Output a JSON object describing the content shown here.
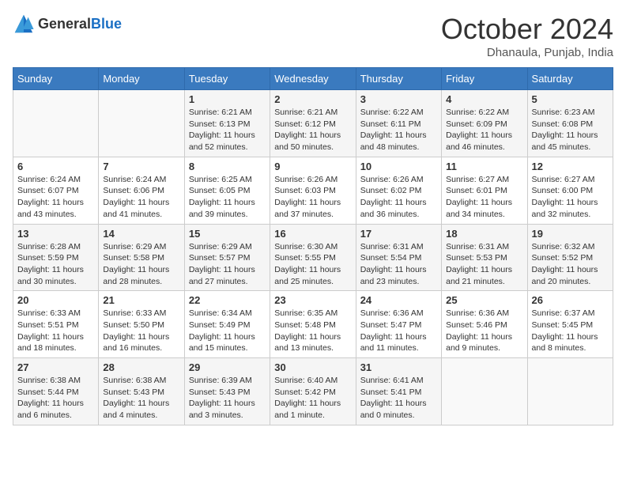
{
  "header": {
    "logo_general": "General",
    "logo_blue": "Blue",
    "title": "October 2024",
    "location": "Dhanaula, Punjab, India"
  },
  "calendar": {
    "days_of_week": [
      "Sunday",
      "Monday",
      "Tuesday",
      "Wednesday",
      "Thursday",
      "Friday",
      "Saturday"
    ],
    "weeks": [
      [
        {
          "day": "",
          "info": ""
        },
        {
          "day": "",
          "info": ""
        },
        {
          "day": "1",
          "info": "Sunrise: 6:21 AM\nSunset: 6:13 PM\nDaylight: 11 hours and 52 minutes."
        },
        {
          "day": "2",
          "info": "Sunrise: 6:21 AM\nSunset: 6:12 PM\nDaylight: 11 hours and 50 minutes."
        },
        {
          "day": "3",
          "info": "Sunrise: 6:22 AM\nSunset: 6:11 PM\nDaylight: 11 hours and 48 minutes."
        },
        {
          "day": "4",
          "info": "Sunrise: 6:22 AM\nSunset: 6:09 PM\nDaylight: 11 hours and 46 minutes."
        },
        {
          "day": "5",
          "info": "Sunrise: 6:23 AM\nSunset: 6:08 PM\nDaylight: 11 hours and 45 minutes."
        }
      ],
      [
        {
          "day": "6",
          "info": "Sunrise: 6:24 AM\nSunset: 6:07 PM\nDaylight: 11 hours and 43 minutes."
        },
        {
          "day": "7",
          "info": "Sunrise: 6:24 AM\nSunset: 6:06 PM\nDaylight: 11 hours and 41 minutes."
        },
        {
          "day": "8",
          "info": "Sunrise: 6:25 AM\nSunset: 6:05 PM\nDaylight: 11 hours and 39 minutes."
        },
        {
          "day": "9",
          "info": "Sunrise: 6:26 AM\nSunset: 6:03 PM\nDaylight: 11 hours and 37 minutes."
        },
        {
          "day": "10",
          "info": "Sunrise: 6:26 AM\nSunset: 6:02 PM\nDaylight: 11 hours and 36 minutes."
        },
        {
          "day": "11",
          "info": "Sunrise: 6:27 AM\nSunset: 6:01 PM\nDaylight: 11 hours and 34 minutes."
        },
        {
          "day": "12",
          "info": "Sunrise: 6:27 AM\nSunset: 6:00 PM\nDaylight: 11 hours and 32 minutes."
        }
      ],
      [
        {
          "day": "13",
          "info": "Sunrise: 6:28 AM\nSunset: 5:59 PM\nDaylight: 11 hours and 30 minutes."
        },
        {
          "day": "14",
          "info": "Sunrise: 6:29 AM\nSunset: 5:58 PM\nDaylight: 11 hours and 28 minutes."
        },
        {
          "day": "15",
          "info": "Sunrise: 6:29 AM\nSunset: 5:57 PM\nDaylight: 11 hours and 27 minutes."
        },
        {
          "day": "16",
          "info": "Sunrise: 6:30 AM\nSunset: 5:55 PM\nDaylight: 11 hours and 25 minutes."
        },
        {
          "day": "17",
          "info": "Sunrise: 6:31 AM\nSunset: 5:54 PM\nDaylight: 11 hours and 23 minutes."
        },
        {
          "day": "18",
          "info": "Sunrise: 6:31 AM\nSunset: 5:53 PM\nDaylight: 11 hours and 21 minutes."
        },
        {
          "day": "19",
          "info": "Sunrise: 6:32 AM\nSunset: 5:52 PM\nDaylight: 11 hours and 20 minutes."
        }
      ],
      [
        {
          "day": "20",
          "info": "Sunrise: 6:33 AM\nSunset: 5:51 PM\nDaylight: 11 hours and 18 minutes."
        },
        {
          "day": "21",
          "info": "Sunrise: 6:33 AM\nSunset: 5:50 PM\nDaylight: 11 hours and 16 minutes."
        },
        {
          "day": "22",
          "info": "Sunrise: 6:34 AM\nSunset: 5:49 PM\nDaylight: 11 hours and 15 minutes."
        },
        {
          "day": "23",
          "info": "Sunrise: 6:35 AM\nSunset: 5:48 PM\nDaylight: 11 hours and 13 minutes."
        },
        {
          "day": "24",
          "info": "Sunrise: 6:36 AM\nSunset: 5:47 PM\nDaylight: 11 hours and 11 minutes."
        },
        {
          "day": "25",
          "info": "Sunrise: 6:36 AM\nSunset: 5:46 PM\nDaylight: 11 hours and 9 minutes."
        },
        {
          "day": "26",
          "info": "Sunrise: 6:37 AM\nSunset: 5:45 PM\nDaylight: 11 hours and 8 minutes."
        }
      ],
      [
        {
          "day": "27",
          "info": "Sunrise: 6:38 AM\nSunset: 5:44 PM\nDaylight: 11 hours and 6 minutes."
        },
        {
          "day": "28",
          "info": "Sunrise: 6:38 AM\nSunset: 5:43 PM\nDaylight: 11 hours and 4 minutes."
        },
        {
          "day": "29",
          "info": "Sunrise: 6:39 AM\nSunset: 5:43 PM\nDaylight: 11 hours and 3 minutes."
        },
        {
          "day": "30",
          "info": "Sunrise: 6:40 AM\nSunset: 5:42 PM\nDaylight: 11 hours and 1 minute."
        },
        {
          "day": "31",
          "info": "Sunrise: 6:41 AM\nSunset: 5:41 PM\nDaylight: 11 hours and 0 minutes."
        },
        {
          "day": "",
          "info": ""
        },
        {
          "day": "",
          "info": ""
        }
      ]
    ]
  }
}
